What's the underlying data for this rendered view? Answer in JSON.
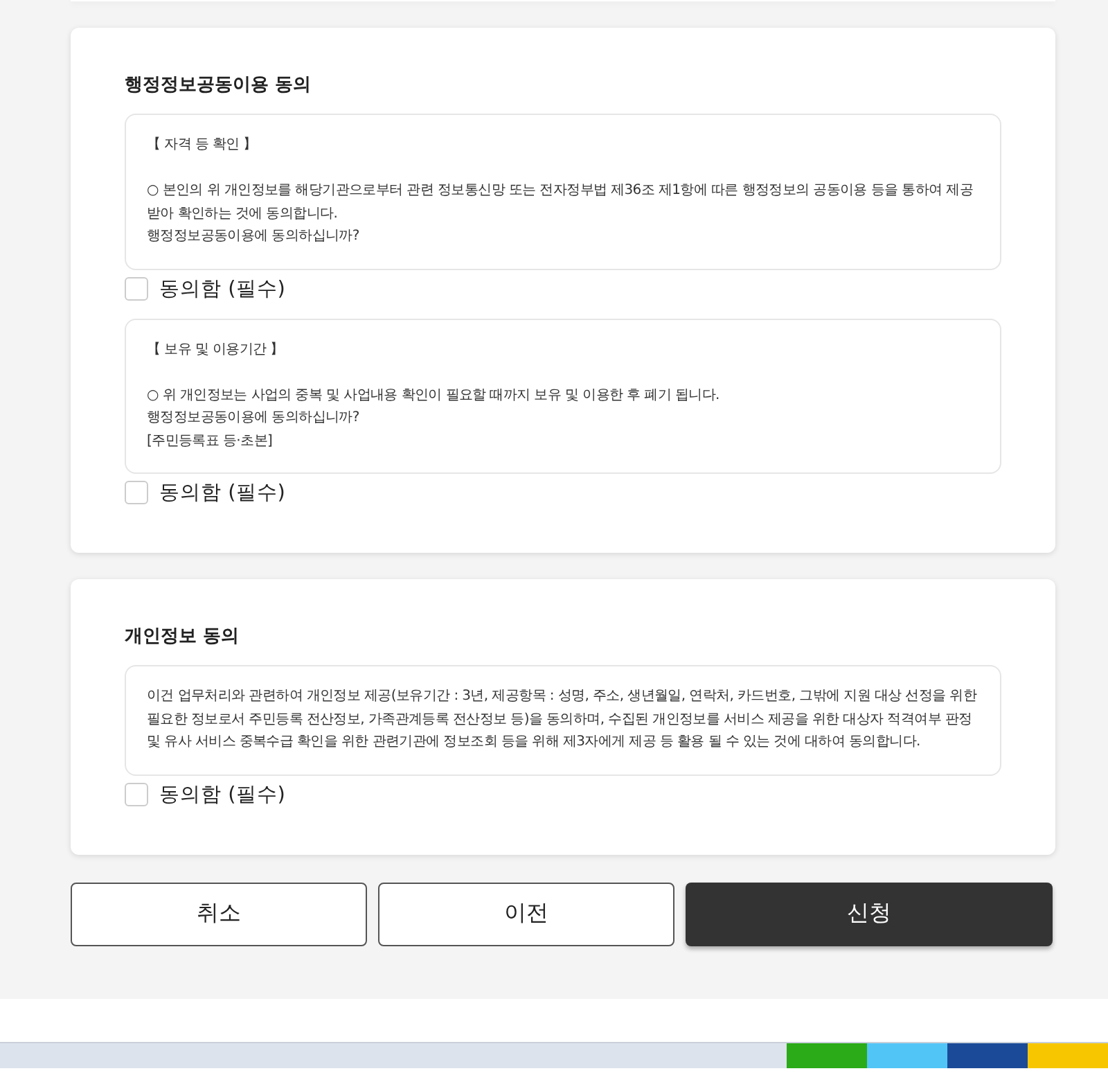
{
  "sections": [
    {
      "title": "행정정보공동이용 동의",
      "items": [
        {
          "heading": "【 자격 등 확인 】",
          "lines": [
            "○ 본인의 위 개인정보를 해당기관으로부터 관련 정보통신망 또는 전자정부법 제36조 제1항에 따른 행정정보의 공동이용 등을 통하여 제공받아 확인하는 것에 동의합니다.",
            "행정정보공동이용에 동의하십니까?"
          ],
          "checkbox": {
            "label": "동의함 (필수)",
            "checked": false
          }
        },
        {
          "heading": "【 보유 및 이용기간 】",
          "lines": [
            "○ 위 개인정보는 사업의 중복 및 사업내용 확인이 필요할 때까지 보유 및 이용한 후 폐기 됩니다.",
            "행정정보공동이용에 동의하십니까?",
            "[주민등록표 등·초본]"
          ],
          "checkbox": {
            "label": "동의함 (필수)",
            "checked": false
          }
        }
      ]
    },
    {
      "title": "개인정보 동의",
      "items": [
        {
          "lines": [
            "이건 업무처리와 관련하여 개인정보 제공(보유기간 : 3년, 제공항목 : 성명, 주소, 생년월일, 연락처, 카드번호, 그밖에 지원 대상 선정을 위한 필요한 정보로서 주민등록 전산정보, 가족관계등록 전산정보 등)을 동의하며, 수집된 개인정보를 서비스 제공을 위한 대상자 적격여부 판정 및 유사 서비스 중복수급 확인을 위한 관련기관에 정보조회 등을 위해 제3자에게 제공 등 활용 될 수 있는 것에 대하여 동의합니다."
          ],
          "checkbox": {
            "label": "동의함 (필수)",
            "checked": false
          }
        }
      ]
    }
  ],
  "buttons": [
    {
      "label": "취소",
      "kind": "outline"
    },
    {
      "label": "이전",
      "kind": "outline"
    },
    {
      "label": "신청",
      "kind": "primary"
    }
  ],
  "share": [
    {
      "color": "#2aab17"
    },
    {
      "color": "#52c5f7"
    },
    {
      "color": "#1b4b98"
    },
    {
      "color": "#f7c600"
    }
  ]
}
